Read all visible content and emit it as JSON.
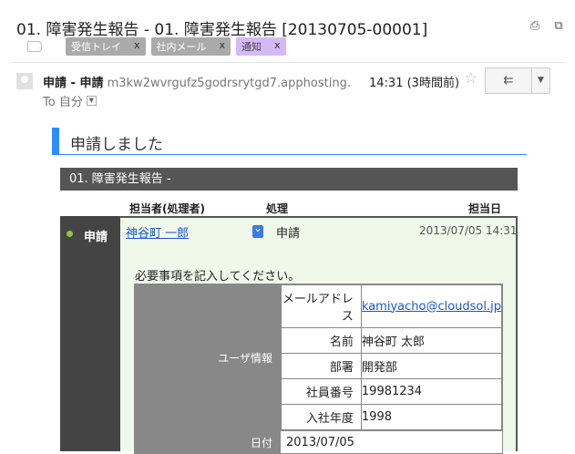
{
  "subject": "01. 障害発生報告 - 01. 障害発生報告 [20130705-00001]",
  "header_icons": [
    "print-icon",
    "new-window-icon"
  ],
  "labels": [
    {
      "text": "受信トレイ",
      "remove": "x"
    },
    {
      "text": "社内メール",
      "remove": "x"
    },
    {
      "text": "通知",
      "remove": "x"
    }
  ],
  "sender": {
    "name": "申請 - 申請",
    "address": "m3kw2wvrgufz5godrsrytgd7.apphosting.",
    "time": "14:31 (3時間前)",
    "to_label": "To 自分"
  },
  "heading": "申請しました",
  "section_title": "01. 障害発生報告 -",
  "columns": {
    "assignee": "担当者(処理者)",
    "action": "処理",
    "date": "担当日"
  },
  "entry": {
    "status": "申請",
    "user": "神谷町 一郎",
    "action": "申請",
    "date": "2013/07/05 14:31",
    "note": "必要事項を記入してください。"
  },
  "user_info": {
    "category": "ユーザ情報",
    "rows": [
      {
        "key": "メールアドレス",
        "value": "kamiyacho@cloudsol.jp"
      },
      {
        "key": "名前",
        "value": "神谷町 太郎"
      },
      {
        "key": "部署",
        "value": "開発部"
      },
      {
        "key": "社員番号",
        "value": "19981234"
      },
      {
        "key": "入社年度",
        "value": "1998"
      }
    ]
  },
  "date_row": {
    "key": "日付",
    "value": "2013/07/05"
  },
  "colors": {
    "accent": "#2d8cff",
    "status_dot": "#8bc34a",
    "link": "#1a56d6"
  }
}
